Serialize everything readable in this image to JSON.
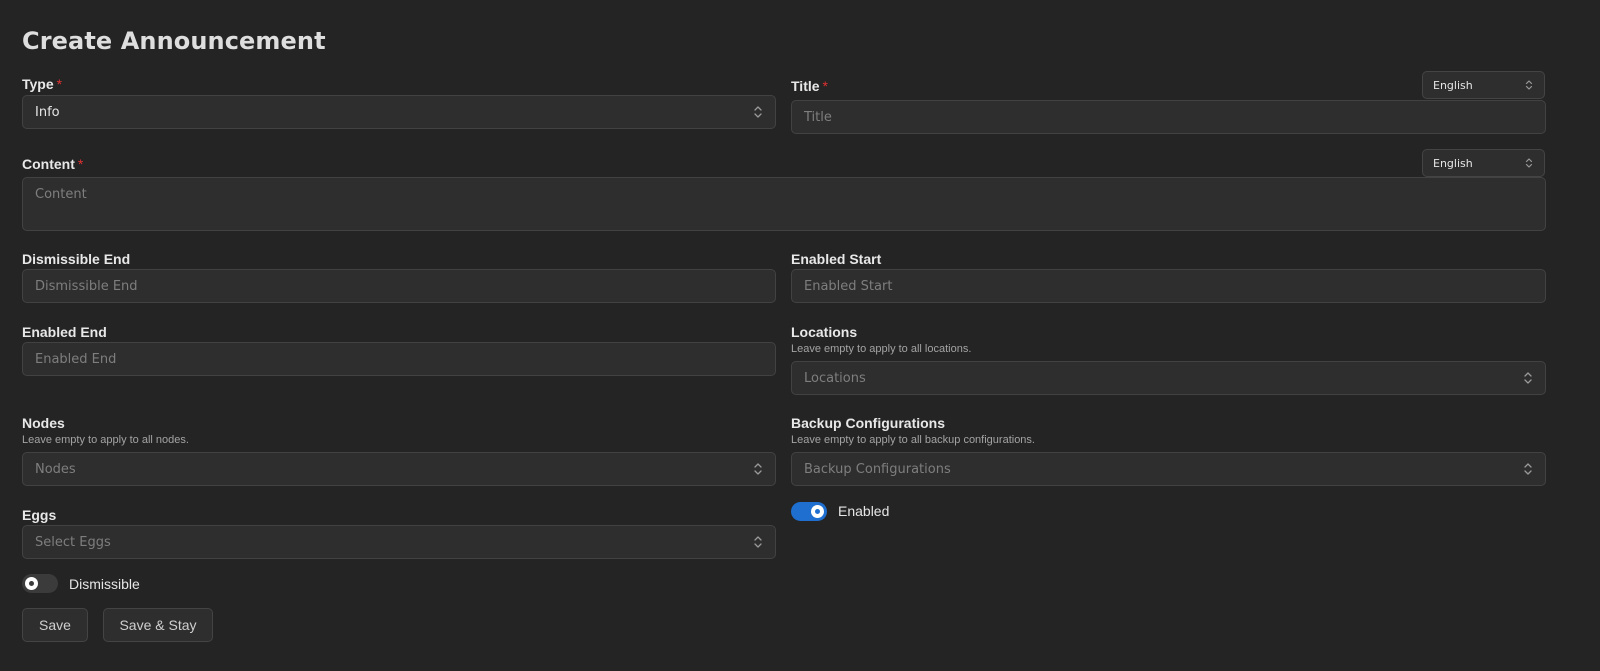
{
  "page": {
    "title": "Create Announcement"
  },
  "form": {
    "type": {
      "label": "Type",
      "required_mark": "*",
      "value": "Info",
      "icon": "chevron-updown-icon"
    },
    "title": {
      "label": "Title",
      "required_mark": "*",
      "placeholder": "Title",
      "language": "English"
    },
    "content": {
      "label": "Content",
      "required_mark": "*",
      "placeholder": "Content",
      "language": "English"
    },
    "dismissible_end": {
      "label": "Dismissible End",
      "placeholder": "Dismissible End"
    },
    "enabled_start": {
      "label": "Enabled Start",
      "placeholder": "Enabled Start"
    },
    "enabled_end": {
      "label": "Enabled End",
      "placeholder": "Enabled End"
    },
    "locations": {
      "label": "Locations",
      "hint": "Leave empty to apply to all locations.",
      "placeholder": "Locations"
    },
    "nodes": {
      "label": "Nodes",
      "hint": "Leave empty to apply to all nodes.",
      "placeholder": "Nodes"
    },
    "backup_configurations": {
      "label": "Backup Configurations",
      "hint": "Leave empty to apply to all backup configurations.",
      "placeholder": "Backup Configurations"
    },
    "eggs": {
      "label": "Eggs",
      "placeholder": "Select Eggs"
    },
    "enabled": {
      "label": "Enabled",
      "checked": true
    },
    "dismissible": {
      "label": "Dismissible",
      "checked": false
    }
  },
  "actions": {
    "save_label": "Save",
    "save_stay_label": "Save & Stay"
  },
  "colors": {
    "background": "#242424",
    "accent": "#1f6fd0",
    "required": "#e03131"
  }
}
